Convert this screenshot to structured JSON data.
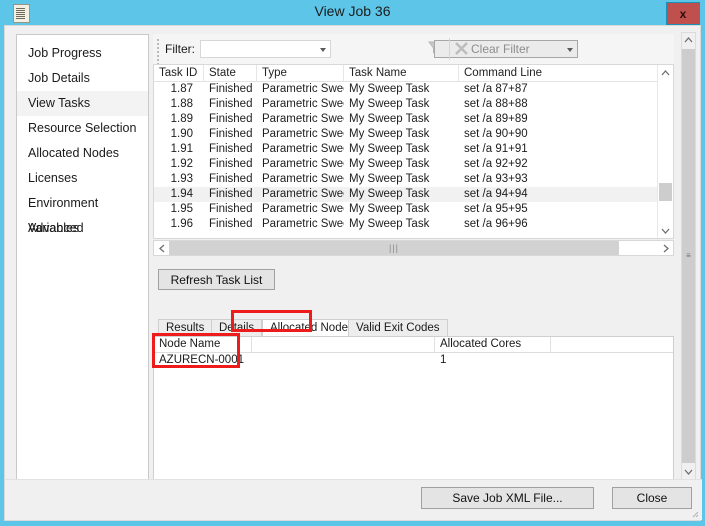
{
  "window": {
    "title": "View Job 36",
    "app_icon": "document-icon",
    "close_label": "x",
    "accent_color": "#5dc6e8",
    "close_button_color": "#c0504d",
    "annotation_color": "#ee1b1b"
  },
  "sidebar": {
    "items": [
      {
        "label": "Job Progress",
        "selected": false
      },
      {
        "label": "Job Details",
        "selected": false
      },
      {
        "label": "View Tasks",
        "selected": true
      },
      {
        "label": "Resource Selection",
        "selected": false
      },
      {
        "label": "Allocated Nodes",
        "selected": false
      },
      {
        "label": "Licenses",
        "selected": false
      },
      {
        "label": "Environment Variables",
        "selected": false
      },
      {
        "label": "Advanced",
        "selected": false
      }
    ]
  },
  "toolbar": {
    "filter_label": "Filter:",
    "filter_field_value": "",
    "filter_value_value": "",
    "funnel_icon": "funnel-icon",
    "clear_icon": "clear-x-icon",
    "clear_label": "Clear Filter"
  },
  "task_grid": {
    "columns": [
      "Task ID",
      "State",
      "Type",
      "Task Name",
      "Command Line"
    ],
    "rows": [
      {
        "id": "1.87",
        "state": "Finished",
        "type": "Parametric Sweep",
        "name": "My Sweep Task",
        "cmd": "set /a 87+87",
        "selected": false
      },
      {
        "id": "1.88",
        "state": "Finished",
        "type": "Parametric Sweep",
        "name": "My Sweep Task",
        "cmd": "set /a 88+88",
        "selected": false
      },
      {
        "id": "1.89",
        "state": "Finished",
        "type": "Parametric Sweep",
        "name": "My Sweep Task",
        "cmd": "set /a 89+89",
        "selected": false
      },
      {
        "id": "1.90",
        "state": "Finished",
        "type": "Parametric Sweep",
        "name": "My Sweep Task",
        "cmd": "set /a 90+90",
        "selected": false
      },
      {
        "id": "1.91",
        "state": "Finished",
        "type": "Parametric Sweep",
        "name": "My Sweep Task",
        "cmd": "set /a 91+91",
        "selected": false
      },
      {
        "id": "1.92",
        "state": "Finished",
        "type": "Parametric Sweep",
        "name": "My Sweep Task",
        "cmd": "set /a 92+92",
        "selected": false
      },
      {
        "id": "1.93",
        "state": "Finished",
        "type": "Parametric Sweep",
        "name": "My Sweep Task",
        "cmd": "set /a 93+93",
        "selected": false
      },
      {
        "id": "1.94",
        "state": "Finished",
        "type": "Parametric Sweep",
        "name": "My Sweep Task",
        "cmd": "set /a 94+94",
        "selected": true
      },
      {
        "id": "1.95",
        "state": "Finished",
        "type": "Parametric Sweep",
        "name": "My Sweep Task",
        "cmd": "set /a 95+95",
        "selected": false
      },
      {
        "id": "1.96",
        "state": "Finished",
        "type": "Parametric Sweep",
        "name": "My Sweep Task",
        "cmd": "set /a 96+96",
        "selected": false
      }
    ]
  },
  "actions": {
    "refresh_label": "Refresh Task List"
  },
  "tabs": [
    {
      "label": "Results",
      "active": false
    },
    {
      "label": "Details",
      "active": false
    },
    {
      "label": "Allocated Nodes",
      "active": true
    },
    {
      "label": "Valid Exit Codes",
      "active": false
    }
  ],
  "node_grid": {
    "columns": [
      "Node Name",
      "",
      "Allocated Cores",
      ""
    ],
    "rows": [
      {
        "node_name": "AZURECN-0001",
        "spacer": "",
        "cores": "1",
        "tail": ""
      }
    ]
  },
  "footer": {
    "save_label": "Save Job XML File...",
    "close_label": "Close"
  }
}
